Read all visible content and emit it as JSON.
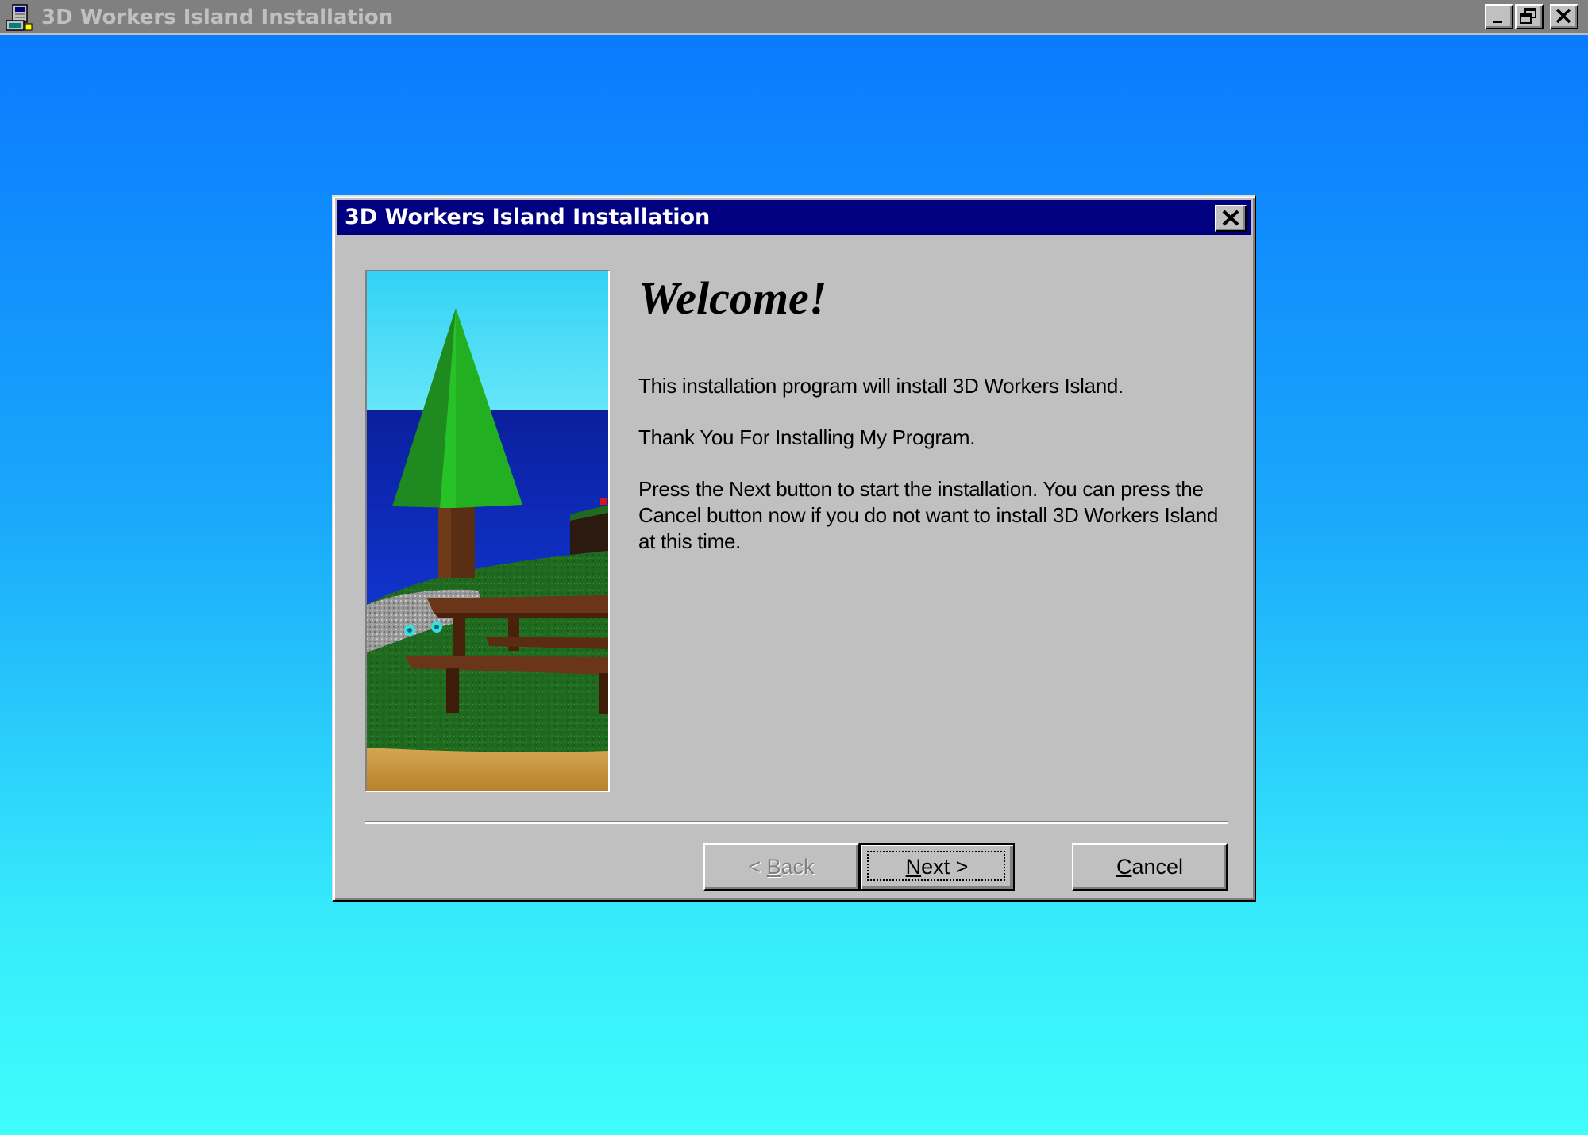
{
  "outer_window": {
    "title": "3D Workers Island Installation",
    "app_icon": "setup-computer-icon",
    "controls": [
      "minimize-icon",
      "restore-icon",
      "close-icon"
    ]
  },
  "dialog": {
    "title": "3D Workers Island Installation",
    "close_icon": "close-icon",
    "heading": "Welcome!",
    "paragraphs": [
      "This installation program will install 3D Workers Island.",
      "Thank You For Installing My Program.",
      "Press the Next button to start the installation. You can press the Cancel button now if you do not want to install 3D Workers Island at this time."
    ],
    "buttons": {
      "back": {
        "prefix": "< ",
        "accel": "B",
        "rest": "ack",
        "enabled": false
      },
      "next": {
        "accel": "N",
        "rest": "ext >",
        "enabled": true,
        "default": true
      },
      "cancel": {
        "accel": "C",
        "rest": "ancel",
        "enabled": true
      }
    }
  },
  "colors": {
    "desktop_top": "#0a7bfe",
    "desktop_bottom": "#3efdfb",
    "dialog_face": "#c0c0c0",
    "active_titlebar": "#000080",
    "inactive_titlebar": "#808080"
  }
}
